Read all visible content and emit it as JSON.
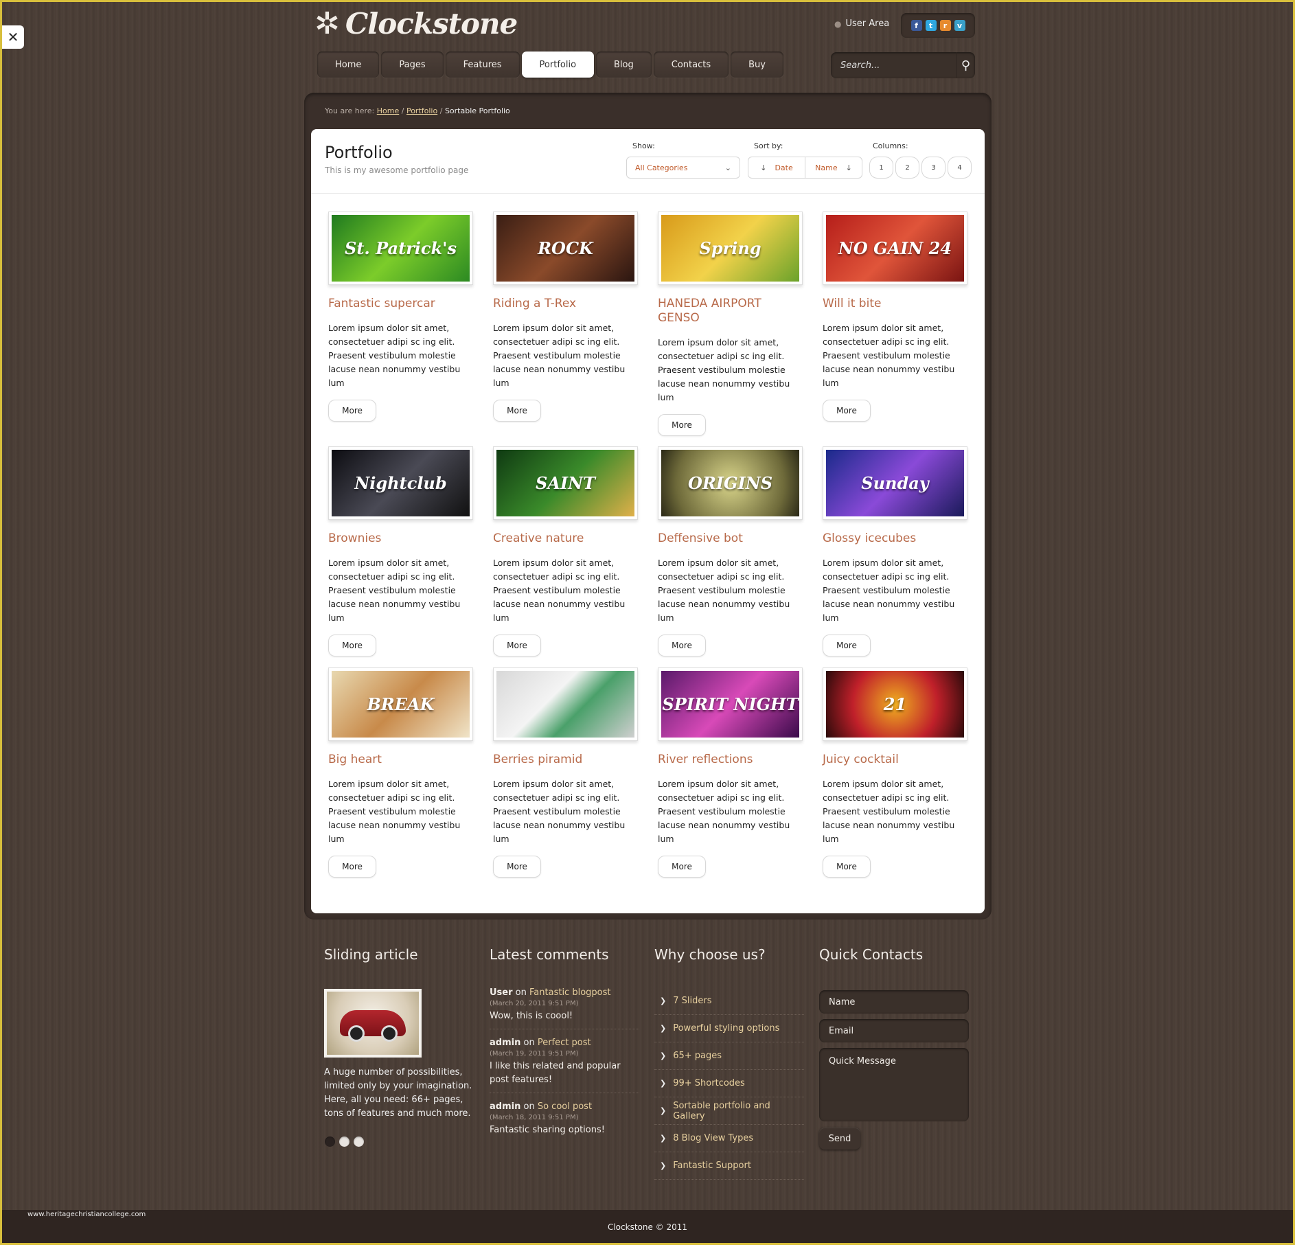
{
  "brand": {
    "name": "Clockstone"
  },
  "header": {
    "user_area": "User Area",
    "social": [
      {
        "icon": "facebook-icon",
        "glyph": "f",
        "color": "#3b5998"
      },
      {
        "icon": "twitter-icon",
        "glyph": "t",
        "color": "#2fa8e0"
      },
      {
        "icon": "rss-icon",
        "glyph": "r",
        "color": "#e68a2e"
      },
      {
        "icon": "vimeo-icon",
        "glyph": "v",
        "color": "#3aa0c8"
      }
    ],
    "search_placeholder": "Search..."
  },
  "nav": [
    "Home",
    "Pages",
    "Features",
    "Portfolio",
    "Blog",
    "Contacts",
    "Buy"
  ],
  "nav_active": "Portfolio",
  "breadcrumb": {
    "prefix": "You are here:",
    "home": "Home",
    "portfolio": "Portfolio",
    "current": "Sortable Portfolio",
    "sep": "/"
  },
  "portfolio": {
    "title": "Portfolio",
    "subtitle": "This is my awesome portfolio page",
    "show_label": "Show:",
    "category": "All Categories",
    "sort_label": "Sort by:",
    "sort_date": "Date",
    "sort_name": "Name",
    "columns_label": "Columns:",
    "columns": [
      "1",
      "2",
      "3",
      "4"
    ],
    "more_label": "More",
    "items": [
      {
        "title": "Fantastic supercar",
        "text": "Lorem ipsum dolor sit amet, consectetuer adipi sc ing elit. Praesent vestibulum molestie lacuse nean nonummy vestibu lum",
        "thumb_text": "St. Patrick's",
        "bg": "linear-gradient(135deg,#1f7a1f,#7ccc2a 50%,#2c8a22)"
      },
      {
        "title": "Riding a T-Rex",
        "text": "Lorem ipsum dolor sit amet, consectetuer adipi sc ing elit. Praesent vestibulum molestie lacuse nean nonummy vestibu lum",
        "thumb_text": "ROCK",
        "bg": "linear-gradient(135deg,#3a1e14,#8a4a2a 50%,#2a1510)"
      },
      {
        "title": "HANEDA AIRPORT GENSO",
        "text": "Lorem ipsum dolor sit amet, consectetuer adipi sc ing elit. Praesent vestibulum molestie lacuse nean nonummy vestibu lum",
        "thumb_text": "Spring",
        "bg": "linear-gradient(135deg,#d89a1a,#f2d24a 50%,#6aa22a)"
      },
      {
        "title": "Will it bite",
        "text": "Lorem ipsum dolor sit amet, consectetuer adipi sc ing elit. Praesent vestibulum molestie lacuse nean nonummy vestibu lum",
        "thumb_text": "NO GAIN 24",
        "bg": "linear-gradient(135deg,#b51e1a,#e0553a 50%,#7a1412)"
      },
      {
        "title": "Brownies",
        "text": "Lorem ipsum dolor sit amet, consectetuer adipi sc ing elit. Praesent vestibulum molestie lacuse nean nonummy vestibu lum",
        "thumb_text": "Nightclub",
        "bg": "linear-gradient(135deg,#0d0d12,#4a4a55 50%,#111)"
      },
      {
        "title": "Creative nature",
        "text": "Lorem ipsum dolor sit amet, consectetuer adipi sc ing elit. Praesent vestibulum molestie lacuse nean nonummy vestibu lum",
        "thumb_text": "SAINT",
        "bg": "linear-gradient(135deg,#0f3a12,#3a8a2a 50%,#e0b04a)"
      },
      {
        "title": "Deffensive bot",
        "text": "Lorem ipsum dolor sit amet, consectetuer adipi sc ing elit. Praesent vestibulum molestie lacuse nean nonummy vestibu lum",
        "thumb_text": "ORIGINS",
        "bg": "radial-gradient(circle,#d8d48a,#6e6a3a 70%,#2a2816)"
      },
      {
        "title": "Glossy icecubes",
        "text": "Lorem ipsum dolor sit amet, consectetuer adipi sc ing elit. Praesent vestibulum molestie lacuse nean nonummy vestibu lum",
        "thumb_text": "Sunday",
        "bg": "linear-gradient(135deg,#1a2a8a,#8a4ad8 50%,#1a1a5a)"
      },
      {
        "title": "Big heart",
        "text": "Lorem ipsum dolor sit amet, consectetuer adipi sc ing elit. Praesent vestibulum molestie lacuse nean nonummy vestibu lum",
        "thumb_text": "BREAK",
        "bg": "linear-gradient(135deg,#e8d8b0,#c88a4a 50%,#f0e4c8)"
      },
      {
        "title": "Berries piramid",
        "text": "Lorem ipsum dolor sit amet, consectetuer adipi sc ing elit. Praesent vestibulum molestie lacuse nean nonummy vestibu lum",
        "thumb_text": "",
        "bg": "linear-gradient(135deg,#d8d8d8,#f4f4f4 40%,#4aa06a 60%,#cfcfcf)"
      },
      {
        "title": "River reflections",
        "text": "Lorem ipsum dolor sit amet, consectetuer adipi sc ing elit. Praesent vestibulum molestie lacuse nean nonummy vestibu lum",
        "thumb_text": "SPIRIT NIGHT",
        "bg": "linear-gradient(135deg,#5a1a6a,#d84ab8 50%,#3a0a4a)"
      },
      {
        "title": "Juicy cocktail",
        "text": "Lorem ipsum dolor sit amet, consectetuer adipi sc ing elit. Praesent vestibulum molestie lacuse nean nonummy vestibu lum",
        "thumb_text": "21",
        "bg": "radial-gradient(circle,#f0b020,#c0202a 55%,#2a0a0a)"
      }
    ]
  },
  "footer": {
    "sliding": {
      "heading": "Sliding article",
      "text": "A huge number of possibilities, limited only by your imagination. Here, all you need: 66+ pages, tons of features and much more."
    },
    "comments": {
      "heading": "Latest comments",
      "items": [
        {
          "user": "User",
          "on": "on",
          "post": "Fantastic blogpost",
          "date": "(March 20, 2011 9:51 PM)",
          "text": "Wow, this is coool!"
        },
        {
          "user": "admin",
          "on": "on",
          "post": "Perfect post",
          "date": "(March 19, 2011 9:51 PM)",
          "text": "I like this related and popular post features!"
        },
        {
          "user": "admin",
          "on": "on",
          "post": "So cool post",
          "date": "(March 18, 2011 9:51 PM)",
          "text": "Fantastic sharing options!"
        }
      ]
    },
    "why": {
      "heading": "Why choose us?",
      "items": [
        "7 Sliders",
        "Powerful styling options",
        "65+ pages",
        "99+ Shortcodes",
        "Sortable portfolio and Gallery",
        "8 Blog View Types",
        "Fantastic Support"
      ]
    },
    "contacts": {
      "heading": "Quick Contacts",
      "name": "Name",
      "email": "Email",
      "message": "Quick Message",
      "send": "Send"
    },
    "copyright": "Clockstone © 2011",
    "watermark": "www.heritagechristiancollege.com"
  }
}
